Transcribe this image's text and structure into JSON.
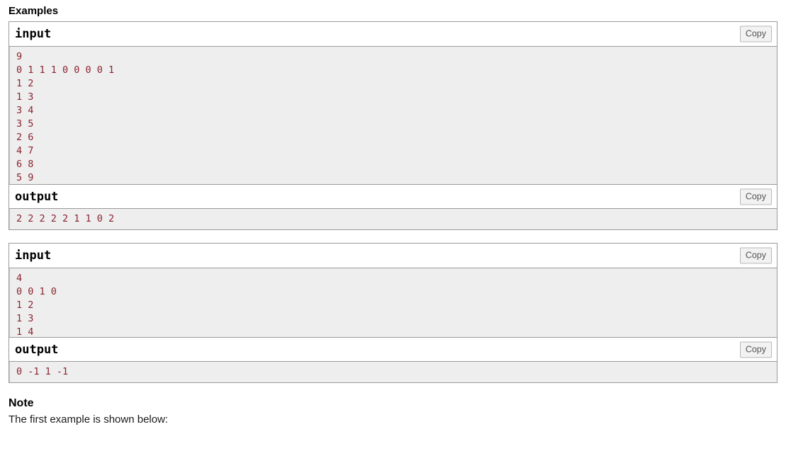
{
  "headings": {
    "examples": "Examples",
    "note": "Note"
  },
  "note": {
    "text": "The first example is shown below:"
  },
  "labels": {
    "input": "input",
    "output": "output",
    "copy": "Copy"
  },
  "colors": {
    "data_text": "#8b2430",
    "data_background": "#eeeeee",
    "block_border": "#9a9a9a",
    "copy_button_background": "#f2f2f2",
    "copy_button_border": "#b8b8b8",
    "copy_button_text": "#555555",
    "heading_text": "#000000",
    "page_background": "#ffffff"
  },
  "examples": [
    {
      "input": "9\n0 1 1 1 0 0 0 0 1\n1 2\n1 3\n3 4\n3 5\n2 6\n4 7\n6 8\n5 9",
      "output": "2 2 2 2 2 1 1 0 2"
    },
    {
      "input": "4\n0 0 1 0\n1 2\n1 3\n1 4",
      "output": "0 -1 1 -1"
    }
  ]
}
